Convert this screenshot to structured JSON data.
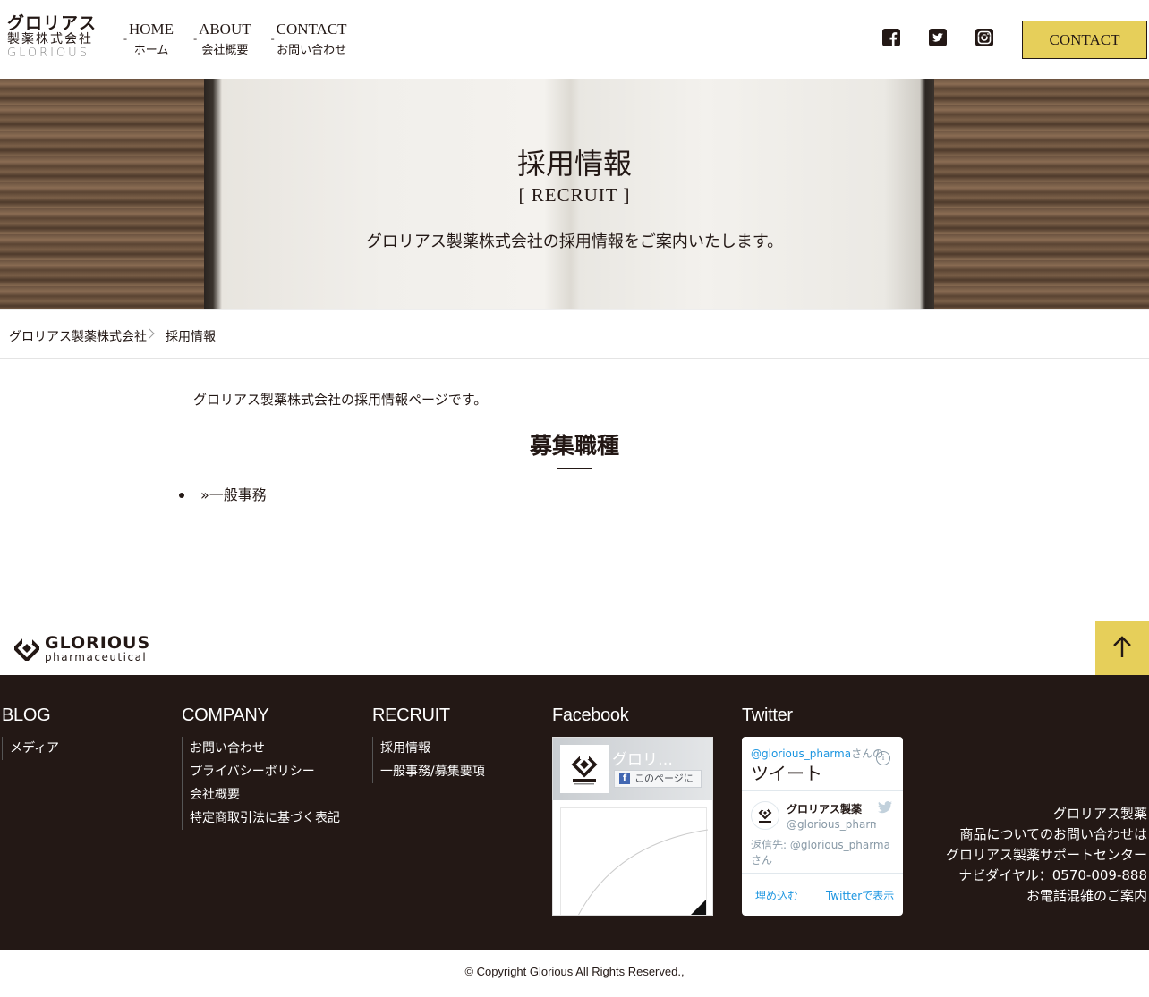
{
  "header": {
    "logo": {
      "line1": "グロリアス",
      "line2": "製薬株式会社",
      "line3": "GLORIOUS"
    },
    "nav": [
      {
        "en": "HOME",
        "ja": "ホーム"
      },
      {
        "en": "ABOUT",
        "ja": "会社概要"
      },
      {
        "en": "CONTACT",
        "ja": "お問い合わせ"
      }
    ],
    "social": [
      "facebook-icon",
      "twitter-icon",
      "instagram-icon"
    ],
    "cta_label": "CONTACT",
    "accent_color": "#e6cf5a"
  },
  "hero": {
    "title": "採用情報",
    "subtitle": "[ RECRUIT ]",
    "description": "グロリアス製薬株式会社の採用情報をご案内いたします。"
  },
  "breadcrumb": {
    "home": "グロリアス製薬株式会社",
    "current": "採用情報"
  },
  "main": {
    "intro": "グロリアス製薬株式会社の採用情報ページです。",
    "section_title": "募集職種",
    "jobs": [
      "»一般事務"
    ]
  },
  "footer_top": {
    "logo_name": "GLORIOUS",
    "logo_sub": "pharmaceutical"
  },
  "footer": {
    "background": "#231815",
    "blog": {
      "heading": "BLOG",
      "links": [
        "メディア"
      ]
    },
    "company": {
      "heading": "COMPANY",
      "links": [
        "お問い合わせ",
        "プライバシーポリシー",
        "会社概要",
        "特定商取引法に基づく表記"
      ]
    },
    "recruit": {
      "heading": "RECRUIT",
      "links": [
        "採用情報",
        "一般事務/募集要項"
      ]
    },
    "facebook": {
      "heading": "Facebook",
      "page_name": "グロリ…",
      "like_label": "このページに"
    },
    "twitter": {
      "heading": "Twitter",
      "handle": "@glorious_pharma",
      "handle_suffix": "さんの",
      "title": "ツイート",
      "account_name": "グロリアス製薬",
      "account_user": "@glorious_pharma",
      "reply": "返信先: @glorious_pharmaさん",
      "embed_label": "埋め込む",
      "view_label": "Twitterで表示"
    },
    "info": [
      "グロリアス製薬",
      "商品についてのお問い合わせは",
      "グロリアス製薬サポートセンター",
      "ナビダイヤル：0570-009-888",
      "お電話混雑のご案内"
    ]
  },
  "copyright": "© Copyright Glorious All Rights Reserved.,"
}
